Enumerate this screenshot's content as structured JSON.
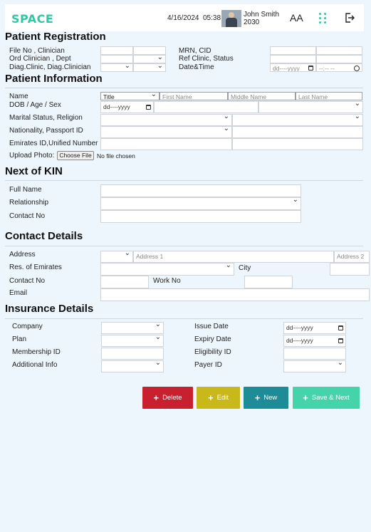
{
  "header": {
    "logo": "SPACE",
    "date": "4/16/2024",
    "time": "05:38",
    "user_name": "John Smith",
    "user_id": "2030",
    "font_size_label": "AA"
  },
  "registration": {
    "title": "Patient Registration",
    "file_clinician_label": "File No , Clinician",
    "ord_clinician_label": "Ord Clinician , Dept",
    "diag_clinic_label": "Diag.Clinic, Diag.Clinician",
    "mrn_label": "MRN, CID",
    "ref_clinic_label": "Ref Clinic, Status",
    "datetime_label": "Date&Time",
    "date_placeholder": "dd----yyyy",
    "time_placeholder": "--:-- --"
  },
  "patient_info": {
    "title": "Patient Information",
    "name_label": "Name",
    "title_select": "Title",
    "first_name_placeholder": "First Name",
    "middle_name_placeholder": "Middle Name",
    "last_name_placeholder": "Last Name",
    "dob_label": "DOB / Age / Sex",
    "dob_placeholder": "dd----yyyy",
    "marital_label": "Marital Status, Religion",
    "nationality_label": "Nationality, Passport ID",
    "emirates_label": "Emirates ID,Unified Number",
    "upload_label": "Upload Photo:",
    "choose_file": "Choose File",
    "no_file": "No file chosen"
  },
  "next_of_kin": {
    "title": "Next of KIN",
    "full_name_label": "Full Name",
    "relationship_label": "Relationship",
    "contact_label": "Contact No"
  },
  "contact": {
    "title": "Contact Details",
    "address_label": "Address",
    "address1_placeholder": "Address 1",
    "address2_placeholder": "Address 2",
    "emirates_label": "Res. of Emirates",
    "city_label": "City",
    "contact_label": "Contact No",
    "work_label": "Work No",
    "email_label": "Email"
  },
  "insurance": {
    "title": "Insurance Details",
    "company_label": "Company",
    "plan_label": "Plan",
    "membership_label": "Membership ID",
    "additional_label": "Additional Info",
    "issue_label": "Issue Date",
    "expiry_label": "Expiry Date",
    "eligibility_label": "Eligibility ID",
    "payer_label": "Payer ID",
    "date_placeholder": "dd----yyyy"
  },
  "actions": {
    "delete": "Delete",
    "edit": "Edit",
    "new": "New",
    "save_next": "Save & Next"
  },
  "colors": {
    "accent": "#2fc7a4",
    "delete": "#c8202f",
    "edit": "#c9b81a",
    "new": "#1e8c96",
    "save_next": "#45d4a9"
  }
}
